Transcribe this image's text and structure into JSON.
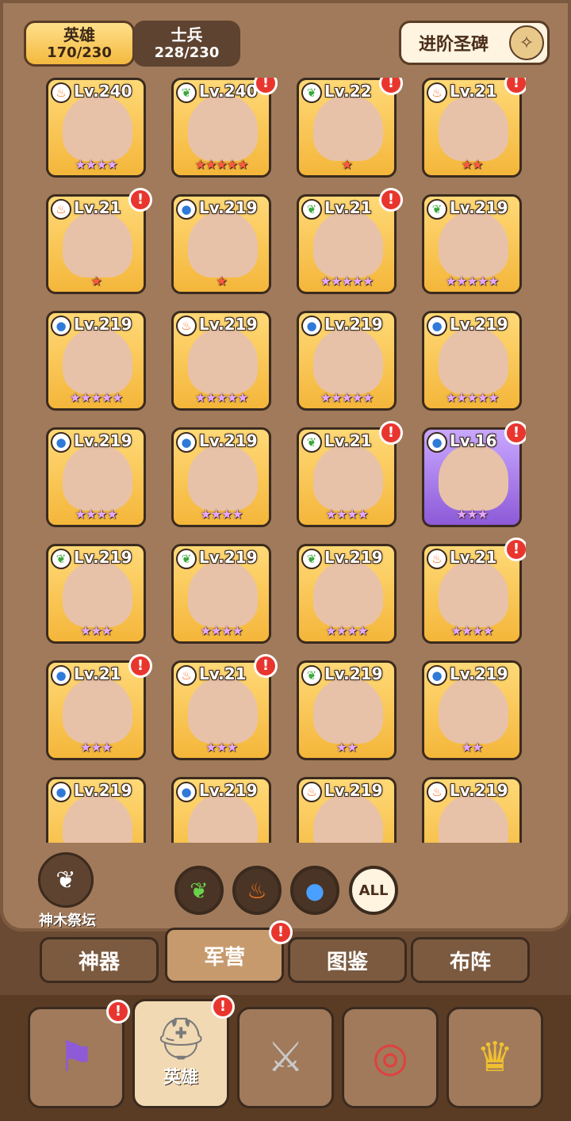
{
  "header": {
    "hero_tab": {
      "label": "英雄",
      "count": "170/230"
    },
    "soldier_tab": {
      "label": "士兵",
      "count": "228/230"
    },
    "advance_button": {
      "label": "进阶圣碑",
      "icon": "compass-emblem-icon"
    }
  },
  "heroes": [
    {
      "level": "Lv.240",
      "element": "fire",
      "stars": "★★★★",
      "star_color": "purple",
      "alert": false,
      "bg": "gold"
    },
    {
      "level": "Lv.240",
      "element": "leaf",
      "stars": "★★★★★",
      "star_color": "red",
      "alert": true,
      "bg": "gold"
    },
    {
      "level": "Lv.22",
      "element": "leaf",
      "stars": "★",
      "star_color": "red",
      "alert": true,
      "bg": "gold"
    },
    {
      "level": "Lv.21",
      "element": "fire",
      "stars": "★★",
      "star_color": "red",
      "alert": true,
      "bg": "gold"
    },
    {
      "level": "Lv.21",
      "element": "fire",
      "stars": "★",
      "star_color": "red",
      "alert": true,
      "bg": "gold"
    },
    {
      "level": "Lv.219",
      "element": "water",
      "stars": "★",
      "star_color": "red",
      "alert": false,
      "bg": "gold"
    },
    {
      "level": "Lv.21",
      "element": "leaf",
      "stars": "★★★★★",
      "star_color": "purple",
      "alert": true,
      "bg": "gold"
    },
    {
      "level": "Lv.219",
      "element": "leaf",
      "stars": "★★★★★",
      "star_color": "purple",
      "alert": false,
      "bg": "gold"
    },
    {
      "level": "Lv.219",
      "element": "water",
      "stars": "★★★★★",
      "star_color": "purple",
      "alert": false,
      "bg": "gold"
    },
    {
      "level": "Lv.219",
      "element": "fire",
      "stars": "★★★★★",
      "star_color": "purple",
      "alert": false,
      "bg": "gold"
    },
    {
      "level": "Lv.219",
      "element": "water",
      "stars": "★★★★★",
      "star_color": "purple",
      "alert": false,
      "bg": "gold"
    },
    {
      "level": "Lv.219",
      "element": "water",
      "stars": "★★★★★",
      "star_color": "purple",
      "alert": false,
      "bg": "gold"
    },
    {
      "level": "Lv.219",
      "element": "water",
      "stars": "★★★★",
      "star_color": "purple",
      "alert": false,
      "bg": "gold"
    },
    {
      "level": "Lv.219",
      "element": "water",
      "stars": "★★★★",
      "star_color": "purple",
      "alert": false,
      "bg": "gold"
    },
    {
      "level": "Lv.21",
      "element": "leaf",
      "stars": "★★★★",
      "star_color": "purple",
      "alert": true,
      "bg": "gold"
    },
    {
      "level": "Lv.16",
      "element": "water",
      "stars": "★★★",
      "star_color": "purple",
      "alert": true,
      "bg": "purple"
    },
    {
      "level": "Lv.219",
      "element": "leaf",
      "stars": "★★★",
      "star_color": "purple",
      "alert": false,
      "bg": "gold"
    },
    {
      "level": "Lv.219",
      "element": "leaf",
      "stars": "★★★★",
      "star_color": "purple",
      "alert": false,
      "bg": "gold"
    },
    {
      "level": "Lv.219",
      "element": "leaf",
      "stars": "★★★★",
      "star_color": "purple",
      "alert": false,
      "bg": "gold"
    },
    {
      "level": "Lv.21",
      "element": "fire",
      "stars": "★★★★",
      "star_color": "purple",
      "alert": true,
      "bg": "gold"
    },
    {
      "level": "Lv.21",
      "element": "water",
      "stars": "★★★",
      "star_color": "purple",
      "alert": true,
      "bg": "gold"
    },
    {
      "level": "Lv.21",
      "element": "fire",
      "stars": "★★★",
      "star_color": "purple",
      "alert": true,
      "bg": "gold"
    },
    {
      "level": "Lv.219",
      "element": "leaf",
      "stars": "★★",
      "star_color": "purple",
      "alert": false,
      "bg": "gold"
    },
    {
      "level": "Lv.219",
      "element": "water",
      "stars": "★★",
      "star_color": "purple",
      "alert": false,
      "bg": "gold"
    },
    {
      "level": "Lv.219",
      "element": "water",
      "stars": "",
      "star_color": "purple",
      "alert": false,
      "bg": "gold"
    },
    {
      "level": "Lv.219",
      "element": "water",
      "stars": "",
      "star_color": "purple",
      "alert": false,
      "bg": "gold"
    },
    {
      "level": "Lv.219",
      "element": "fire",
      "stars": "",
      "star_color": "purple",
      "alert": false,
      "bg": "gold"
    },
    {
      "level": "Lv.219",
      "element": "fire",
      "stars": "",
      "star_color": "purple",
      "alert": false,
      "bg": "gold"
    }
  ],
  "altar": {
    "label": "神木祭坛",
    "icon": "white-tree-icon"
  },
  "filters": [
    {
      "name": "leaf",
      "icon": "leaf-icon",
      "glyph": "❦"
    },
    {
      "name": "fire",
      "icon": "fire-icon",
      "glyph": "♨"
    },
    {
      "name": "water",
      "icon": "water-drop-icon",
      "glyph": "●"
    },
    {
      "name": "all",
      "label": "ALL"
    }
  ],
  "tabs": [
    {
      "label": "神器",
      "active": false,
      "alert": false
    },
    {
      "label": "军营",
      "active": true,
      "alert": true
    },
    {
      "label": "图鉴",
      "active": false,
      "alert": false
    },
    {
      "label": "布阵",
      "active": false,
      "alert": false
    }
  ],
  "bottom_nav": [
    {
      "icon": "banner-sword-icon",
      "label": "",
      "active": false,
      "alert": true
    },
    {
      "icon": "viking-helmet-icon",
      "label": "英雄",
      "active": true,
      "alert": true
    },
    {
      "icon": "crossed-swords-icon",
      "label": "",
      "active": false,
      "alert": false
    },
    {
      "icon": "target-dart-icon",
      "label": "",
      "active": false,
      "alert": false
    },
    {
      "icon": "trophy-icon",
      "label": "",
      "active": false,
      "alert": false
    }
  ],
  "alert_mark": "!"
}
